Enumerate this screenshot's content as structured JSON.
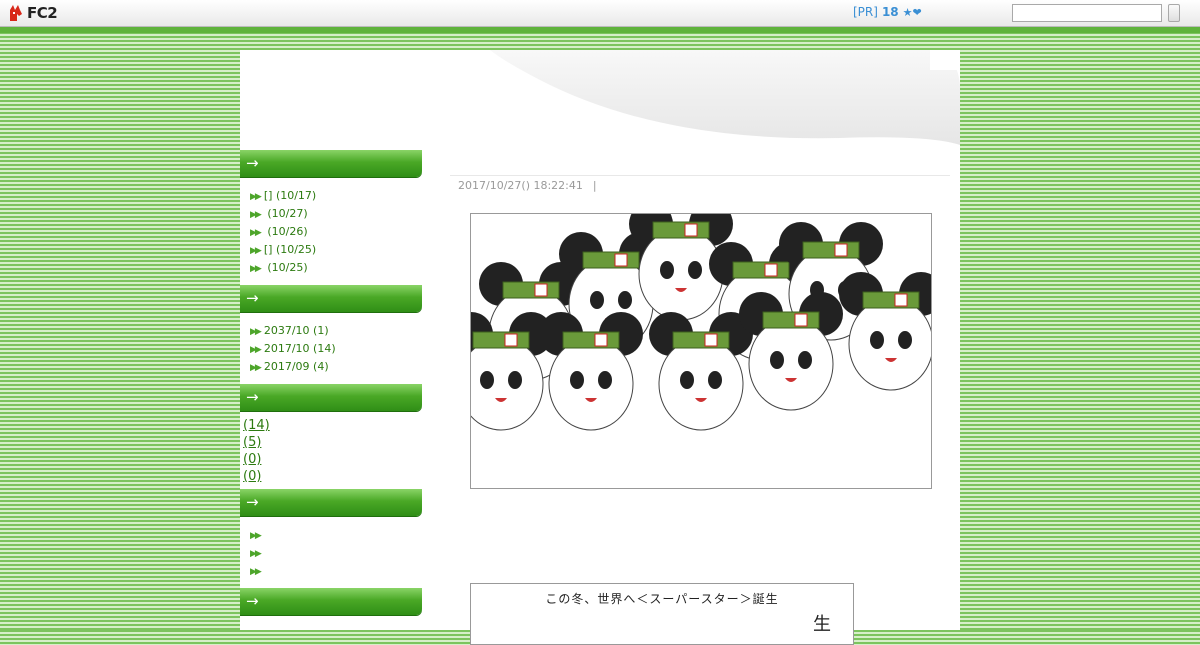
{
  "topbar": {
    "logo_text": "FC2",
    "pr_label": "[PR]",
    "pr_count": "18",
    "pr_icons": "★❤",
    "search_placeholder": ""
  },
  "sidebar": {
    "recent_entries": [
      {
        "title": "[]",
        "date": "(10/17)"
      },
      {
        "title": "",
        "date": "(10/27)"
      },
      {
        "title": "",
        "date": "(10/26)"
      },
      {
        "title": "[]",
        "date": "(10/25)"
      },
      {
        "title": "",
        "date": "(10/25)"
      }
    ],
    "archives": [
      {
        "month": "2037/10",
        "count": "(1)"
      },
      {
        "month": "2017/10",
        "count": "(14)"
      },
      {
        "month": "2017/09",
        "count": "(4)"
      }
    ],
    "categories": [
      "(14)",
      "(5)",
      "(0)",
      "(0)"
    ],
    "section_arrow": "→"
  },
  "entry": {
    "datetime": "2017/10/27() 18:22:41",
    "separator": "|",
    "poster_title": "この冬、世界へ＜スーパースター＞誕生",
    "poster_char": "生"
  },
  "colors": {
    "accent_green": "#4aa826",
    "link_green": "#2c7a10",
    "pr_blue": "#3a8fd4"
  }
}
